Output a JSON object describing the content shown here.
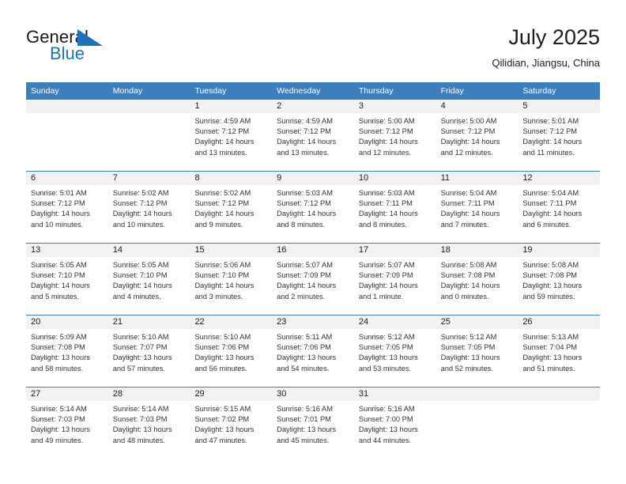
{
  "brand": {
    "name_part1": "General",
    "name_part2": "Blue",
    "flag_icon": "blue-triangle-flag",
    "accent_color": "#1d72bb"
  },
  "header": {
    "title": "July 2025",
    "location": "Qilidian, Jiangsu, China"
  },
  "calendar": {
    "header_color": "#3d7ebf",
    "daynum_band_color": "#f2f2f2",
    "weekday_headers": [
      "Sunday",
      "Monday",
      "Tuesday",
      "Wednesday",
      "Thursday",
      "Friday",
      "Saturday"
    ],
    "weeks": [
      [
        {
          "day": "",
          "empty": true,
          "sunrise": "",
          "sunset": "",
          "daylight_line1": "",
          "daylight_line2": ""
        },
        {
          "day": "",
          "empty": true,
          "sunrise": "",
          "sunset": "",
          "daylight_line1": "",
          "daylight_line2": ""
        },
        {
          "day": "1",
          "empty": false,
          "sunrise": "Sunrise: 4:59 AM",
          "sunset": "Sunset: 7:12 PM",
          "daylight_line1": "Daylight: 14 hours",
          "daylight_line2": "and 13 minutes."
        },
        {
          "day": "2",
          "empty": false,
          "sunrise": "Sunrise: 4:59 AM",
          "sunset": "Sunset: 7:12 PM",
          "daylight_line1": "Daylight: 14 hours",
          "daylight_line2": "and 13 minutes."
        },
        {
          "day": "3",
          "empty": false,
          "sunrise": "Sunrise: 5:00 AM",
          "sunset": "Sunset: 7:12 PM",
          "daylight_line1": "Daylight: 14 hours",
          "daylight_line2": "and 12 minutes."
        },
        {
          "day": "4",
          "empty": false,
          "sunrise": "Sunrise: 5:00 AM",
          "sunset": "Sunset: 7:12 PM",
          "daylight_line1": "Daylight: 14 hours",
          "daylight_line2": "and 12 minutes."
        },
        {
          "day": "5",
          "empty": false,
          "sunrise": "Sunrise: 5:01 AM",
          "sunset": "Sunset: 7:12 PM",
          "daylight_line1": "Daylight: 14 hours",
          "daylight_line2": "and 11 minutes."
        }
      ],
      [
        {
          "day": "6",
          "empty": false,
          "sunrise": "Sunrise: 5:01 AM",
          "sunset": "Sunset: 7:12 PM",
          "daylight_line1": "Daylight: 14 hours",
          "daylight_line2": "and 10 minutes."
        },
        {
          "day": "7",
          "empty": false,
          "sunrise": "Sunrise: 5:02 AM",
          "sunset": "Sunset: 7:12 PM",
          "daylight_line1": "Daylight: 14 hours",
          "daylight_line2": "and 10 minutes."
        },
        {
          "day": "8",
          "empty": false,
          "sunrise": "Sunrise: 5:02 AM",
          "sunset": "Sunset: 7:12 PM",
          "daylight_line1": "Daylight: 14 hours",
          "daylight_line2": "and 9 minutes."
        },
        {
          "day": "9",
          "empty": false,
          "sunrise": "Sunrise: 5:03 AM",
          "sunset": "Sunset: 7:12 PM",
          "daylight_line1": "Daylight: 14 hours",
          "daylight_line2": "and 8 minutes."
        },
        {
          "day": "10",
          "empty": false,
          "sunrise": "Sunrise: 5:03 AM",
          "sunset": "Sunset: 7:11 PM",
          "daylight_line1": "Daylight: 14 hours",
          "daylight_line2": "and 8 minutes."
        },
        {
          "day": "11",
          "empty": false,
          "sunrise": "Sunrise: 5:04 AM",
          "sunset": "Sunset: 7:11 PM",
          "daylight_line1": "Daylight: 14 hours",
          "daylight_line2": "and 7 minutes."
        },
        {
          "day": "12",
          "empty": false,
          "sunrise": "Sunrise: 5:04 AM",
          "sunset": "Sunset: 7:11 PM",
          "daylight_line1": "Daylight: 14 hours",
          "daylight_line2": "and 6 minutes."
        }
      ],
      [
        {
          "day": "13",
          "empty": false,
          "sunrise": "Sunrise: 5:05 AM",
          "sunset": "Sunset: 7:10 PM",
          "daylight_line1": "Daylight: 14 hours",
          "daylight_line2": "and 5 minutes."
        },
        {
          "day": "14",
          "empty": false,
          "sunrise": "Sunrise: 5:05 AM",
          "sunset": "Sunset: 7:10 PM",
          "daylight_line1": "Daylight: 14 hours",
          "daylight_line2": "and 4 minutes."
        },
        {
          "day": "15",
          "empty": false,
          "sunrise": "Sunrise: 5:06 AM",
          "sunset": "Sunset: 7:10 PM",
          "daylight_line1": "Daylight: 14 hours",
          "daylight_line2": "and 3 minutes."
        },
        {
          "day": "16",
          "empty": false,
          "sunrise": "Sunrise: 5:07 AM",
          "sunset": "Sunset: 7:09 PM",
          "daylight_line1": "Daylight: 14 hours",
          "daylight_line2": "and 2 minutes."
        },
        {
          "day": "17",
          "empty": false,
          "sunrise": "Sunrise: 5:07 AM",
          "sunset": "Sunset: 7:09 PM",
          "daylight_line1": "Daylight: 14 hours",
          "daylight_line2": "and 1 minute."
        },
        {
          "day": "18",
          "empty": false,
          "sunrise": "Sunrise: 5:08 AM",
          "sunset": "Sunset: 7:08 PM",
          "daylight_line1": "Daylight: 14 hours",
          "daylight_line2": "and 0 minutes."
        },
        {
          "day": "19",
          "empty": false,
          "sunrise": "Sunrise: 5:08 AM",
          "sunset": "Sunset: 7:08 PM",
          "daylight_line1": "Daylight: 13 hours",
          "daylight_line2": "and 59 minutes."
        }
      ],
      [
        {
          "day": "20",
          "empty": false,
          "sunrise": "Sunrise: 5:09 AM",
          "sunset": "Sunset: 7:08 PM",
          "daylight_line1": "Daylight: 13 hours",
          "daylight_line2": "and 58 minutes."
        },
        {
          "day": "21",
          "empty": false,
          "sunrise": "Sunrise: 5:10 AM",
          "sunset": "Sunset: 7:07 PM",
          "daylight_line1": "Daylight: 13 hours",
          "daylight_line2": "and 57 minutes."
        },
        {
          "day": "22",
          "empty": false,
          "sunrise": "Sunrise: 5:10 AM",
          "sunset": "Sunset: 7:06 PM",
          "daylight_line1": "Daylight: 13 hours",
          "daylight_line2": "and 56 minutes."
        },
        {
          "day": "23",
          "empty": false,
          "sunrise": "Sunrise: 5:11 AM",
          "sunset": "Sunset: 7:06 PM",
          "daylight_line1": "Daylight: 13 hours",
          "daylight_line2": "and 54 minutes."
        },
        {
          "day": "24",
          "empty": false,
          "sunrise": "Sunrise: 5:12 AM",
          "sunset": "Sunset: 7:05 PM",
          "daylight_line1": "Daylight: 13 hours",
          "daylight_line2": "and 53 minutes."
        },
        {
          "day": "25",
          "empty": false,
          "sunrise": "Sunrise: 5:12 AM",
          "sunset": "Sunset: 7:05 PM",
          "daylight_line1": "Daylight: 13 hours",
          "daylight_line2": "and 52 minutes."
        },
        {
          "day": "26",
          "empty": false,
          "sunrise": "Sunrise: 5:13 AM",
          "sunset": "Sunset: 7:04 PM",
          "daylight_line1": "Daylight: 13 hours",
          "daylight_line2": "and 51 minutes."
        }
      ],
      [
        {
          "day": "27",
          "empty": false,
          "sunrise": "Sunrise: 5:14 AM",
          "sunset": "Sunset: 7:03 PM",
          "daylight_line1": "Daylight: 13 hours",
          "daylight_line2": "and 49 minutes."
        },
        {
          "day": "28",
          "empty": false,
          "sunrise": "Sunrise: 5:14 AM",
          "sunset": "Sunset: 7:03 PM",
          "daylight_line1": "Daylight: 13 hours",
          "daylight_line2": "and 48 minutes."
        },
        {
          "day": "29",
          "empty": false,
          "sunrise": "Sunrise: 5:15 AM",
          "sunset": "Sunset: 7:02 PM",
          "daylight_line1": "Daylight: 13 hours",
          "daylight_line2": "and 47 minutes."
        },
        {
          "day": "30",
          "empty": false,
          "sunrise": "Sunrise: 5:16 AM",
          "sunset": "Sunset: 7:01 PM",
          "daylight_line1": "Daylight: 13 hours",
          "daylight_line2": "and 45 minutes."
        },
        {
          "day": "31",
          "empty": false,
          "sunrise": "Sunrise: 5:16 AM",
          "sunset": "Sunset: 7:00 PM",
          "daylight_line1": "Daylight: 13 hours",
          "daylight_line2": "and 44 minutes."
        },
        {
          "day": "",
          "empty": true,
          "sunrise": "",
          "sunset": "",
          "daylight_line1": "",
          "daylight_line2": ""
        },
        {
          "day": "",
          "empty": true,
          "sunrise": "",
          "sunset": "",
          "daylight_line1": "",
          "daylight_line2": ""
        }
      ]
    ]
  }
}
